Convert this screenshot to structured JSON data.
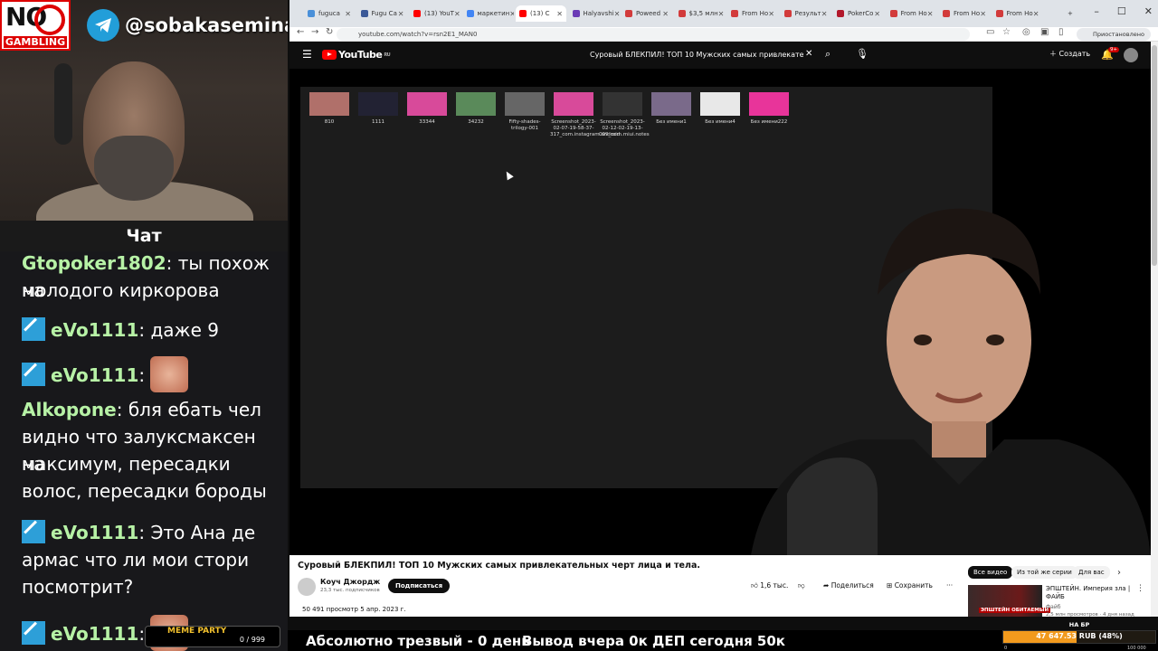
{
  "stream": {
    "telegram_handle": "@sobakasemina",
    "logo_top": "NO",
    "logo_bottom": "GAMBLING",
    "chat_title": "Чат"
  },
  "chat": {
    "messages": [
      {
        "user": "Gtopoker1802",
        "text": "ты похож на",
        "user_color": "#b7f2a6"
      },
      {
        "user": "",
        "text": "молодого киркорова"
      },
      {
        "user": "eVo1111",
        "text": "даже 9",
        "user_color": "#b7f2a6"
      },
      {
        "user": "eVo1111",
        "text": "",
        "user_color": "#b7f2a6"
      },
      {
        "user": "Alkopone",
        "text": "бля ебать чел",
        "user_color": "#b7f2a6"
      },
      {
        "user": "",
        "text": "видно что залуксмаксен на"
      },
      {
        "user": "",
        "text": "максимум, пересадки"
      },
      {
        "user": "",
        "text": "волос, пересадки бороды"
      },
      {
        "user": "eVo1111",
        "text": "Это Ана де",
        "user_color": "#b7f2a6"
      },
      {
        "user": "",
        "text": "армас что ли мои стори"
      },
      {
        "user": "",
        "text": "посмотрит?"
      },
      {
        "user": "eVo1111",
        "text": "",
        "user_color": "#b7f2a6"
      }
    ],
    "meme_party_label": "MEME PARTY",
    "meme_party_count": "0 / 999"
  },
  "browser": {
    "tabs": [
      {
        "label": "fuguca",
        "color": "#4a90d9"
      },
      {
        "label": "Fugu Ca",
        "color": "#3b5998"
      },
      {
        "label": "(13) YouT",
        "color": "#ff0000"
      },
      {
        "label": "маркетин",
        "color": "#4285f4"
      },
      {
        "label": "(13) С",
        "color": "#ff0000"
      },
      {
        "label": "Halyavshi",
        "color": "#6a3bb5"
      },
      {
        "label": "Poweed",
        "color": "#d23b3b"
      },
      {
        "label": "$3,5 млн",
        "color": "#d23b3b"
      },
      {
        "label": "From Ho",
        "color": "#d23b3b"
      },
      {
        "label": "Результ",
        "color": "#d23b3b"
      },
      {
        "label": "PokerCo",
        "color": "#b2182b"
      },
      {
        "label": "From Ho",
        "color": "#d23b3b"
      },
      {
        "label": "From Ho",
        "color": "#d23b3b"
      },
      {
        "label": "From Ho",
        "color": "#d23b3b"
      }
    ],
    "url": "youtube.com/watch?v=rsn2E1_MAN0",
    "paused_label": "Приостановлено"
  },
  "youtube": {
    "logo_text": "YouTube",
    "region": "RU",
    "search_query": "Суровый БЛЕКПИЛ! ТОП 10 Мужских самых привлекательных черт лица и тела",
    "create_label": "Создать",
    "notif_count": "9+",
    "desktop_files": [
      {
        "name": "810",
        "color": "#b0706a"
      },
      {
        "name": "1111",
        "color": "#223"
      },
      {
        "name": "33344",
        "color": "#d84a9a"
      },
      {
        "name": "34232",
        "color": "#5a8a5a"
      },
      {
        "name": "Fifty-shades-trilogy-001",
        "color": "#666"
      },
      {
        "name": "Screenshot_2023-02-07-19-58-37-317_com.instagram.android",
        "color": "#d84a9a"
      },
      {
        "name": "Screenshot_2023-02-12-02-19-13-099_com.miui.notes",
        "color": "#333"
      },
      {
        "name": "Без имени1",
        "color": "#7a6a8a"
      },
      {
        "name": "Без имени4",
        "color": "#e8e8e8"
      },
      {
        "name": "Без имени222",
        "color": "#e8349a"
      }
    ],
    "video_title": "Суровый БЛЕКПИЛ! ТОП 10 Мужских самых привлекательных черт лица и тела.",
    "channel_name": "Коуч Джордж",
    "channel_subs": "23,3 тыс. подписчиков",
    "subscribe_label": "Подписаться",
    "likes": "1,6 тыс.",
    "share_label": "Поделиться",
    "save_label": "Сохранить",
    "views": "50 491 просмотр",
    "date": "5 апр. 2023 г.",
    "chips": [
      "Все видео",
      "Из той же серии",
      "Для вас"
    ],
    "rec_title": "ЭПШТЕЙН. Империя зла | ФАЙБ",
    "rec_channel": "Файб",
    "rec_views": "2,5 млн просмотров · 4 дня назад",
    "rec_tag": "ЭПШТЕЙН ОБИТАЕМЫЙ"
  },
  "banner": {
    "sober_text": "Абсолютно трезвый - 0 день",
    "withdraw_text": "Вывод вчера 0к  ДЕП сегодня 50к",
    "nabr_label": "НА БР",
    "balance": "47 647.53 RUB (48%)",
    "balance_fraction": 0.48,
    "balance_min": "0",
    "balance_max": "100 000"
  }
}
